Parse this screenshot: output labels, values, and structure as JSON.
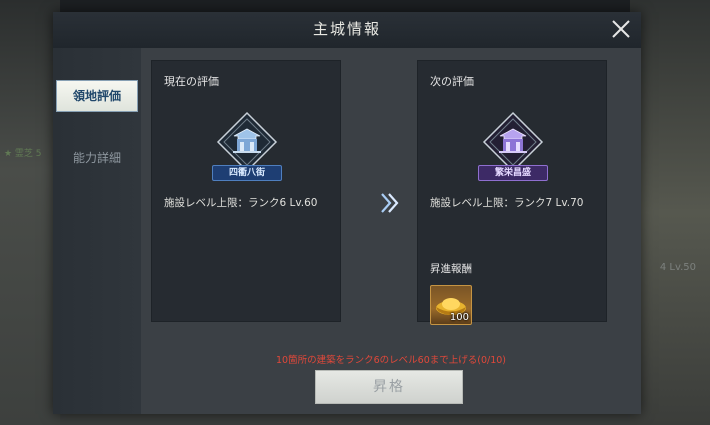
{
  "background": {
    "left_text": "★ 霊芝 5",
    "right_text": "4 Lv.50"
  },
  "dialog": {
    "title": "主城情報",
    "tabs": [
      {
        "label": "領地評価",
        "active": true
      },
      {
        "label": "能力詳細",
        "active": false
      }
    ],
    "current": {
      "title": "現在の評価",
      "rank_name": "四衢八街",
      "rank_color": "blue",
      "cap_text": "施設レベル上限：ランク6 Lv.60"
    },
    "next": {
      "title": "次の評価",
      "rank_name": "繁栄昌盛",
      "rank_color": "purple",
      "cap_text": "施設レベル上限：ランク7 Lv.70",
      "reward_title": "昇進報酬",
      "reward": {
        "icon": "gold-ingot-icon",
        "count": "100"
      }
    },
    "requirement": "10箇所の建築をランク6のレベル60まで上げる(0/10)",
    "promote_button": "昇格"
  },
  "colors": {
    "accent_red": "#e0483a",
    "rank_blue": "#1e3e73",
    "rank_purple": "#3d2a66"
  }
}
